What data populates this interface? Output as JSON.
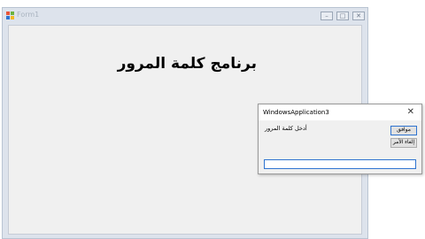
{
  "form1": {
    "title": "Form1",
    "heading": "برنامج كلمة المرور",
    "controls": {
      "minimize": "–",
      "maximize": "□",
      "close": "✕"
    }
  },
  "dialog": {
    "title": "WindowsApplication3",
    "close": "✕",
    "prompt": "أدخل كلمة المرور",
    "ok_label": "موافق",
    "cancel_label": "إلغاء الأمر",
    "input_value": ""
  },
  "colors": {
    "accent": "#2f74d0",
    "window_frame": "#dde3ec",
    "client_bg": "#f0f0f0"
  },
  "icons": {
    "app": "windows-form-icon"
  }
}
